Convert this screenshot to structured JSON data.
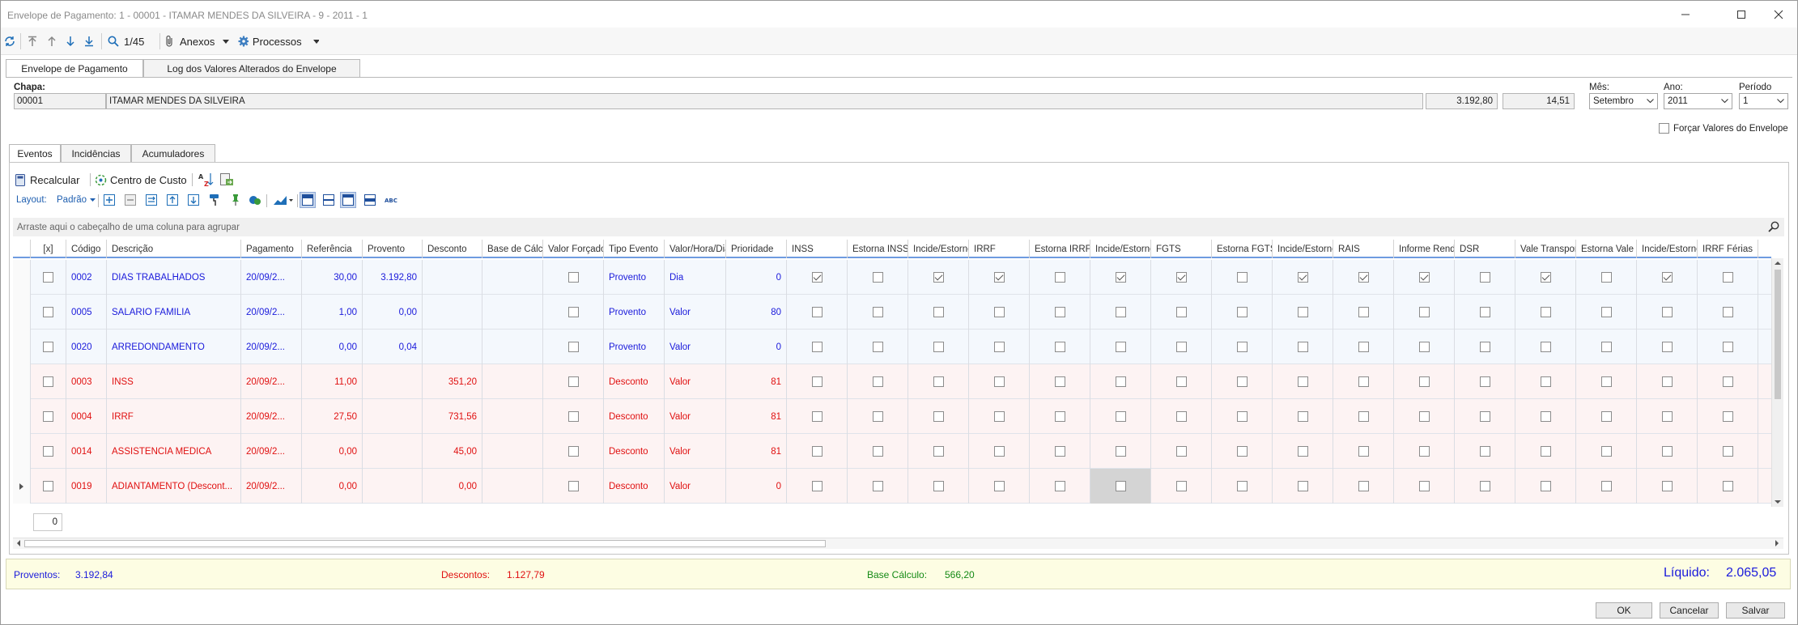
{
  "window": {
    "title": "Envelope de Pagamento: 1 - 00001 - ITAMAR MENDES DA SILVEIRA - 9 - 2011 - 1"
  },
  "toolbar": {
    "record_position": "1/45",
    "attachments_label": "Anexos",
    "processes_label": "Processos"
  },
  "main_tabs": [
    "Envelope de Pagamento",
    "Log dos Valores Alterados do Envelope"
  ],
  "header": {
    "chapa_label": "Chapa:",
    "chapa": "00001",
    "name": "ITAMAR MENDES DA SILVEIRA",
    "value1": "3.192,80",
    "value2": "14,51",
    "mes_label": "Mês:",
    "mes": "Setembro",
    "ano_label": "Ano:",
    "ano": "2011",
    "periodo_label": "Período",
    "periodo": "1",
    "forcar_label": "Forçar Valores do Envelope"
  },
  "sub_tabs": [
    "Eventos",
    "Incidências",
    "Acumuladores"
  ],
  "actions": {
    "recalcular": "Recalcular",
    "centro_custo": "Centro de Custo",
    "layout_label": "Layout:",
    "layout_value": "Padrão"
  },
  "grid": {
    "group_hint": "Arraste aqui o cabeçalho de uma coluna para agrupar",
    "columns": [
      "[x]",
      "Código",
      "Descrição",
      "Pagamento",
      "Referência",
      "Provento",
      "Desconto",
      "Base de Cálculo",
      "Valor Forçado",
      "Tipo Evento",
      "Valor/Hora/Dia",
      "Prioridade",
      "INSS",
      "Estorna INSS",
      "Incide/Estorno",
      "IRRF",
      "Estorna IRRF",
      "Incide/Estorno",
      "FGTS",
      "Estorna FGTS",
      "Incide/Estorno",
      "RAIS",
      "Informe Rendimentos",
      "DSR",
      "Vale Transporte",
      "Estorna Vale",
      "Incide/Estorno",
      "IRRF Férias"
    ],
    "rows": [
      {
        "kind": "prov",
        "codigo": "0002",
        "descricao": "DIAS TRABALHADOS",
        "pagamento": "20/09/2...",
        "referencia": "30,00",
        "provento": "3.192,80",
        "desconto": "",
        "tipo": "Provento",
        "vhd": "Dia",
        "prioridade": "0",
        "checks": [
          1,
          0,
          1,
          1,
          0,
          1,
          1,
          0,
          1,
          1,
          1,
          0,
          1,
          0,
          1,
          0
        ]
      },
      {
        "kind": "prov",
        "codigo": "0005",
        "descricao": "SALARIO FAMILIA",
        "pagamento": "20/09/2...",
        "referencia": "1,00",
        "provento": "0,00",
        "desconto": "",
        "tipo": "Provento",
        "vhd": "Valor",
        "prioridade": "80",
        "checks": [
          0,
          0,
          0,
          0,
          0,
          0,
          0,
          0,
          0,
          0,
          0,
          0,
          0,
          0,
          0,
          0
        ]
      },
      {
        "kind": "prov",
        "codigo": "0020",
        "descricao": "ARREDONDAMENTO",
        "pagamento": "20/09/2...",
        "referencia": "0,00",
        "provento": "0,04",
        "desconto": "",
        "tipo": "Provento",
        "vhd": "Valor",
        "prioridade": "0",
        "checks": [
          0,
          0,
          0,
          0,
          0,
          0,
          0,
          0,
          0,
          0,
          0,
          0,
          0,
          0,
          0,
          0
        ]
      },
      {
        "kind": "desc",
        "codigo": "0003",
        "descricao": "INSS",
        "pagamento": "20/09/2...",
        "referencia": "11,00",
        "provento": "",
        "desconto": "351,20",
        "tipo": "Desconto",
        "vhd": "Valor",
        "prioridade": "81",
        "checks": [
          0,
          0,
          0,
          0,
          0,
          0,
          0,
          0,
          0,
          0,
          0,
          0,
          0,
          0,
          0,
          0
        ]
      },
      {
        "kind": "desc",
        "codigo": "0004",
        "descricao": "IRRF",
        "pagamento": "20/09/2...",
        "referencia": "27,50",
        "provento": "",
        "desconto": "731,56",
        "tipo": "Desconto",
        "vhd": "Valor",
        "prioridade": "81",
        "checks": [
          0,
          0,
          0,
          0,
          0,
          0,
          0,
          0,
          0,
          0,
          0,
          0,
          0,
          0,
          0,
          0
        ]
      },
      {
        "kind": "desc",
        "codigo": "0014",
        "descricao": "ASSISTENCIA MEDICA",
        "pagamento": "20/09/2...",
        "referencia": "0,00",
        "provento": "",
        "desconto": "45,00",
        "tipo": "Desconto",
        "vhd": "Valor",
        "prioridade": "81",
        "checks": [
          0,
          0,
          0,
          0,
          0,
          0,
          0,
          0,
          0,
          0,
          0,
          0,
          0,
          0,
          0,
          0
        ]
      },
      {
        "kind": "desc",
        "codigo": "0019",
        "descricao": "ADIANTAMENTO (Descont...",
        "pagamento": "20/09/2...",
        "referencia": "0,00",
        "provento": "",
        "desconto": "0,00",
        "tipo": "Desconto",
        "vhd": "Valor",
        "prioridade": "0",
        "checks": [
          0,
          0,
          0,
          0,
          0,
          0,
          0,
          0,
          0,
          0,
          0,
          0,
          0,
          0,
          0,
          0
        ]
      }
    ],
    "footer_count": "0"
  },
  "totals": {
    "proventos_label": "Proventos:",
    "proventos": "3.192,84",
    "descontos_label": "Descontos:",
    "descontos": "1.127,79",
    "base_label": "Base Cálculo:",
    "base": "566,20",
    "liquido_label": "Líquido:",
    "liquido": "2.065,05"
  },
  "buttons": {
    "ok": "OK",
    "cancelar": "Cancelar",
    "salvar": "Salvar"
  },
  "colors": {
    "provento": "#1a1adb",
    "desconto": "#e01010",
    "base": "#158a15",
    "accent": "#6e9be0"
  }
}
